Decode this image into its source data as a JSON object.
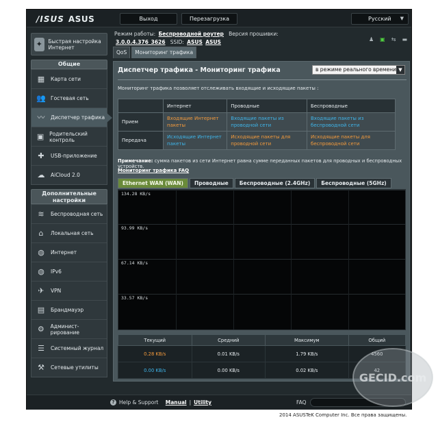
{
  "header": {
    "brand": "ASUS",
    "logout": "Выход",
    "reboot": "Перезагрузка",
    "language": "Русский"
  },
  "quick_setup": "Быстрая настройка Интернет",
  "general": {
    "title": "Общие",
    "items": [
      {
        "label": "Карта сети"
      },
      {
        "label": "Гостевая сеть"
      },
      {
        "label": "Диспетчер трафика"
      },
      {
        "label": "Родительский контроль"
      },
      {
        "label": "USB-приложение"
      },
      {
        "label": "AiCloud 2.0"
      }
    ]
  },
  "advanced": {
    "title": "Дополнительные настройки",
    "items": [
      {
        "label": "Беспроводная сеть"
      },
      {
        "label": "Локальная сеть"
      },
      {
        "label": "Интернет"
      },
      {
        "label": "IPv6"
      },
      {
        "label": "VPN"
      },
      {
        "label": "Брандмауэр"
      },
      {
        "label": "Админист-рирование"
      },
      {
        "label": "Системный журнал"
      },
      {
        "label": "Сетевые утилиты"
      }
    ]
  },
  "info": {
    "mode_label": "Режим работы:",
    "mode_value": "Беспроводной роутер",
    "fw_label": "Версия прошивки:",
    "fw_value": "3.0.0.4.376_3626",
    "ssid_label": "SSID:",
    "ssid1": "ASUS",
    "ssid2": "ASUS"
  },
  "tabs": [
    "QoS",
    "Мониторинг трафика"
  ],
  "panel": {
    "title": "Диспетчер трафика - Мониторинг трафика",
    "mode_select": "в режиме реального времени",
    "description": "Мониторинг трафика позволяет отслеживать входящие и исходящие пакеты :",
    "table": {
      "headers": [
        "",
        "Интернет",
        "Проводные",
        "Беспроводные"
      ],
      "rows": [
        {
          "label": "Прием",
          "internet": "Входящие Интернет пакеты",
          "wired": "Входящие пакеты из проводной сети",
          "wireless": "Входящие пакеты из беспроводной сети"
        },
        {
          "label": "Передача",
          "internet": "Исходящие Интернет пакеты",
          "wired": "Исходящие пакеты для проводной сети",
          "wireless": "Исходящие пакеты для беспроводной сети"
        }
      ]
    },
    "note_bold": "Примечание:",
    "note_text": " сумма пакетов из сети Интернет равна сумме переданных пакетов для проводных и беспроводных устройств.",
    "faq_link": "Мониторинг трафика FAQ",
    "graph_tabs": [
      "Ethernet WAN (WAN)",
      "Проводные",
      "Беспроводные (2.4GHz)",
      "Беспроводные (5GHz)"
    ],
    "y_labels": [
      "134.28 KB/s",
      "93.99 KB/s",
      "67.14 KB/s",
      "33.57 KB/s"
    ],
    "stats": {
      "headers": [
        "Текущий",
        "Средний",
        "Максимум",
        "Общий"
      ],
      "rows": [
        {
          "current": "0.28 KB/s",
          "average": "0.01 KB/s",
          "max": "1.79 KB/s",
          "total": "4560"
        },
        {
          "current": "0.00 KB/s",
          "average": "0.00 KB/s",
          "max": "0.02 KB/s",
          "total": "42"
        }
      ]
    }
  },
  "footer": {
    "help": "Help & Support",
    "manual": "Manual",
    "sep": "|",
    "utility": "Utility",
    "faq": "FAQ",
    "copyright": "2014 ASUSTeK Computer Inc. Все права защищены."
  },
  "watermark": "GECID.com"
}
